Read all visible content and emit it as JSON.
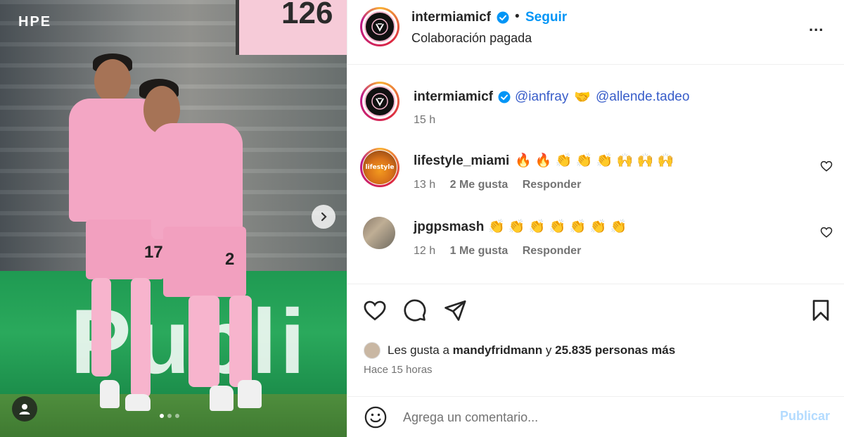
{
  "photo": {
    "watermark": "HPE",
    "scoreboard_text": "126",
    "board_text": "Publi",
    "jersey_numbers": [
      "17",
      "2"
    ],
    "dots": [
      true,
      false,
      false
    ]
  },
  "header": {
    "username": "intermiamicf",
    "dot": "•",
    "follow_label": "Seguir",
    "subtitle": "Colaboración pagada",
    "more": "..."
  },
  "caption": {
    "username": "intermiamicf",
    "mention1": "@ianfray",
    "emoji": "🤝",
    "mention2": "@allende.tadeo",
    "time": "15 h"
  },
  "comments": [
    {
      "username": "lifestyle_miami",
      "text": "🔥 🔥 👏 👏 👏 🙌 🙌 🙌",
      "time": "13 h",
      "likes": "2 Me gusta",
      "reply": "Responder",
      "avatar_text": "lifestyle"
    },
    {
      "username": "jpgpsmash",
      "text": "👏 👏 👏 👏 👏 👏 👏",
      "time": "12 h",
      "likes": "1 Me gusta",
      "reply": "Responder"
    }
  ],
  "likes": {
    "prefix": "Les gusta a",
    "user": "mandyfridmann",
    "connector": "y",
    "others": "25.835 personas más"
  },
  "time_ago": "Hace 15 horas",
  "comment_box": {
    "placeholder": "Agrega un comentario...",
    "publish_label": "Publicar"
  },
  "colors": {
    "accent": "#0095f6",
    "mention": "#385dc9",
    "publish_disabled": "#b3dbff",
    "jersey_pink": "#f3a6c4"
  }
}
